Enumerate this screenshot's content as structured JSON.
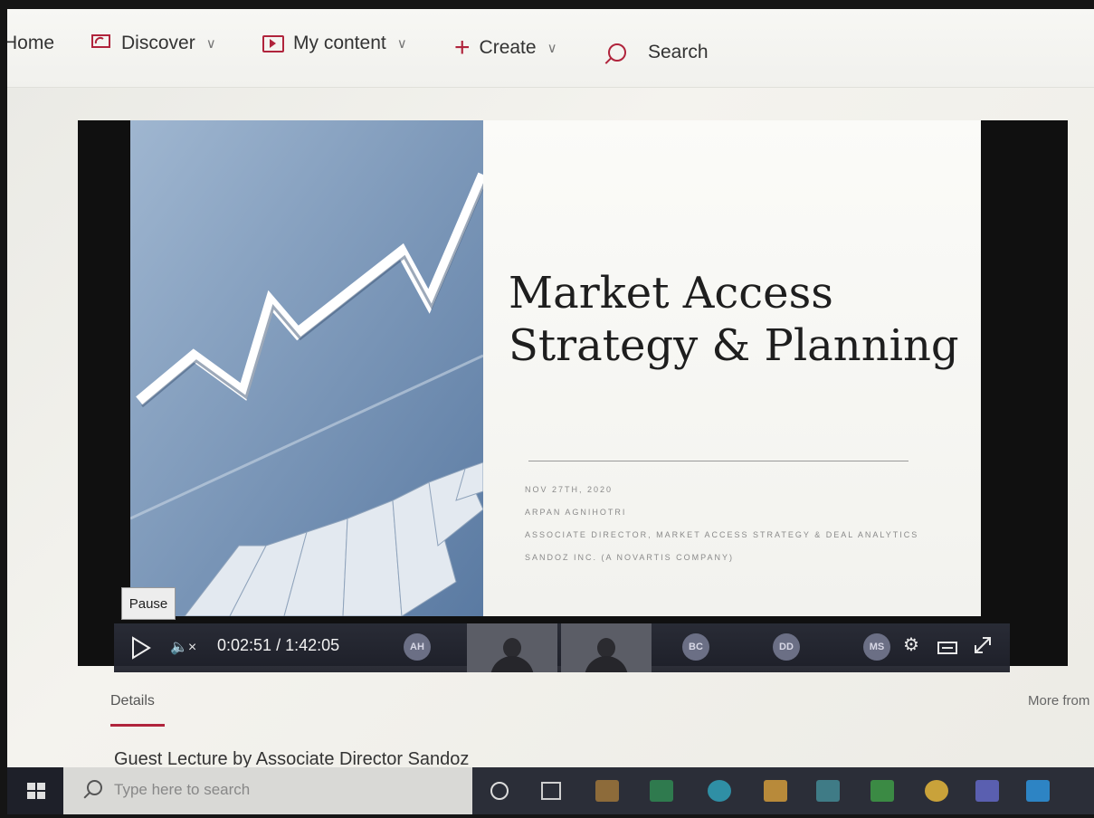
{
  "nav": {
    "home": "Home",
    "discover": "Discover",
    "my_content": "My content",
    "create": "Create",
    "search": "Search"
  },
  "slide": {
    "title_line1": "Market Access",
    "title_line2": "Strategy & Planning",
    "date": "NOV 27TH, 2020",
    "presenter": "ARPAN AGNIHOTRI",
    "role": "ASSOCIATE DIRECTOR, MARKET ACCESS STRATEGY & DEAL ANALYTICS",
    "company": "SANDOZ INC. (A NOVARTIS COMPANY)"
  },
  "player": {
    "tooltip": "Pause",
    "current_time": "0:02:51",
    "separator": "/",
    "duration": "1:42:05",
    "avatars": [
      "AH",
      "BC",
      "DD",
      "MS"
    ]
  },
  "details": {
    "tab": "Details",
    "more_from": "More from",
    "lecture_title": "Guest Lecture by Associate Director Sandoz"
  },
  "taskbar": {
    "search_placeholder": "Type here to search"
  },
  "colors": {
    "accent": "#b0243c",
    "taskbar": "#2b2e38"
  }
}
